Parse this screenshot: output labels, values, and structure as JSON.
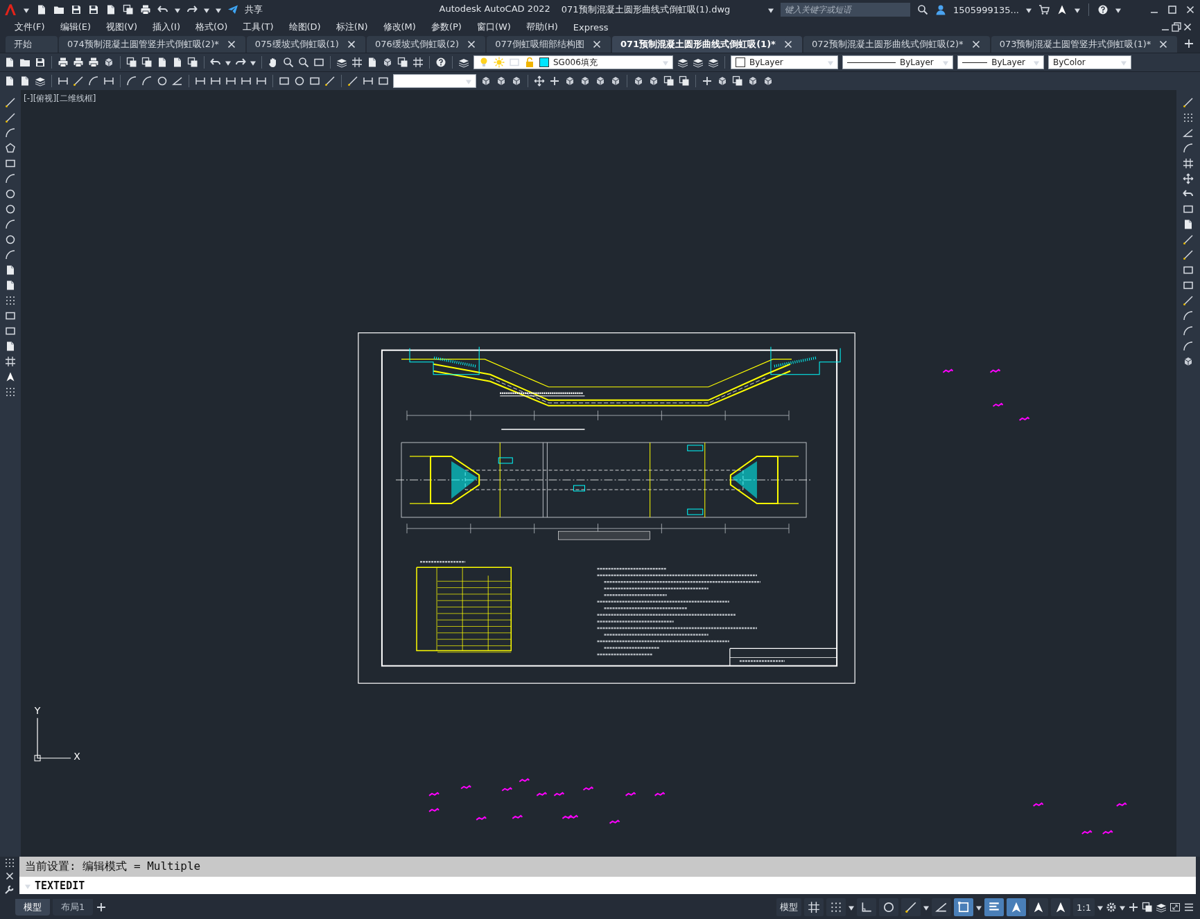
{
  "title_bar": {
    "share": "共享",
    "app": "Autodesk AutoCAD 2022",
    "file": "071预制混凝土圆形曲线式倒虹吸(1).dwg",
    "search": {
      "placeholder": "键入关键字或短语"
    },
    "user": "1505999135..."
  },
  "menu": [
    "文件(F)",
    "编辑(E)",
    "视图(V)",
    "插入(I)",
    "格式(O)",
    "工具(T)",
    "绘图(D)",
    "标注(N)",
    "修改(M)",
    "参数(P)",
    "窗口(W)",
    "帮助(H)",
    "Express"
  ],
  "file_tabs": [
    {
      "label": "开始",
      "selected": false,
      "closable": false
    },
    {
      "label": "074预制混凝土圆管竖井式倒虹吸(2)*",
      "selected": false,
      "closable": true
    },
    {
      "label": "075缓坡式倒虹吸(1)",
      "selected": false,
      "closable": true
    },
    {
      "label": "076缓坡式倒虹吸(2)",
      "selected": false,
      "closable": true
    },
    {
      "label": "077倒虹吸细部结构图",
      "selected": false,
      "closable": true
    },
    {
      "label": "071预制混凝土圆形曲线式倒虹吸(1)*",
      "selected": true,
      "closable": true
    },
    {
      "label": "072预制混凝土圆形曲线式倒虹吸(2)*",
      "selected": false,
      "closable": true
    },
    {
      "label": "073预制混凝土圆管竖井式倒虹吸(1)*",
      "selected": false,
      "closable": true
    }
  ],
  "properties": {
    "layer": "SG006填充",
    "color_setting": "ByLayer",
    "linetype": "ByLayer",
    "lineweight": "ByLayer",
    "plot_style": "ByColor"
  },
  "viewport_label": "[-][俯视][二维线框]",
  "ucs": {
    "x": "X",
    "y": "Y"
  },
  "command_line": {
    "history": "当前设置: 编辑模式 = Multiple",
    "input": "TEXTEDIT"
  },
  "layout_tabs": [
    {
      "label": "模型",
      "selected": true
    },
    {
      "label": "布局1",
      "selected": false
    }
  ],
  "status_bar": {
    "space": "模型",
    "scale": "1:1",
    "toggles": [
      {
        "kind": "grid",
        "on": false
      },
      {
        "kind": "snap",
        "on": false
      },
      {
        "kind": "ortho",
        "on": false
      },
      {
        "kind": "polar",
        "on": false
      },
      {
        "kind": "osnap",
        "on": false
      },
      {
        "kind": "angle",
        "on": false
      },
      {
        "kind": "selection",
        "on": true
      },
      {
        "kind": "lineweight",
        "on": true
      },
      {
        "kind": "annotation",
        "on": true
      },
      {
        "kind": "autoscale",
        "on": false
      },
      {
        "kind": "annoscale",
        "on": false
      }
    ]
  }
}
